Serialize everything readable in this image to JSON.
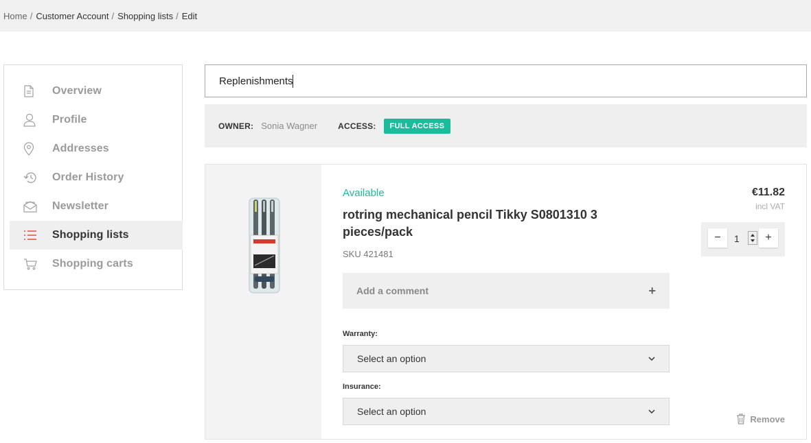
{
  "breadcrumb": {
    "items": [
      "Home",
      "Customer Account",
      "Shopping lists",
      "Edit"
    ],
    "separator": "/"
  },
  "sidebar": {
    "items": [
      {
        "label": "Overview",
        "icon": "document-icon"
      },
      {
        "label": "Profile",
        "icon": "user-icon"
      },
      {
        "label": "Addresses",
        "icon": "location-pin-icon"
      },
      {
        "label": "Order History",
        "icon": "history-icon"
      },
      {
        "label": "Newsletter",
        "icon": "mail-icon"
      },
      {
        "label": "Shopping lists",
        "icon": "list-icon",
        "active": true
      },
      {
        "label": "Shopping carts",
        "icon": "cart-icon"
      }
    ]
  },
  "list_name": {
    "value": "Replenishments"
  },
  "info": {
    "owner_label": "OWNER:",
    "owner_value": "Sonia Wagner",
    "access_label": "ACCESS:",
    "access_badge": "FULL ACCESS"
  },
  "item": {
    "availability": "Available",
    "name": "rotring mechanical pencil Tikky S0801310 3 pieces/pack",
    "sku": "SKU 421481",
    "comment_label": "Add a comment",
    "comment_plus": "+",
    "warranty_label": "Warranty:",
    "warranty_select": "Select an option",
    "insurance_label": "Insurance:",
    "insurance_select": "Select an option",
    "price": "€11.82",
    "vat": "incl VAT",
    "quantity": "1",
    "minus": "−",
    "plus": "+",
    "remove_label": "Remove"
  },
  "colors": {
    "accent": "#1abc9c",
    "active_icon": "#e74c3c",
    "icon_gray": "#a0a0a0"
  }
}
